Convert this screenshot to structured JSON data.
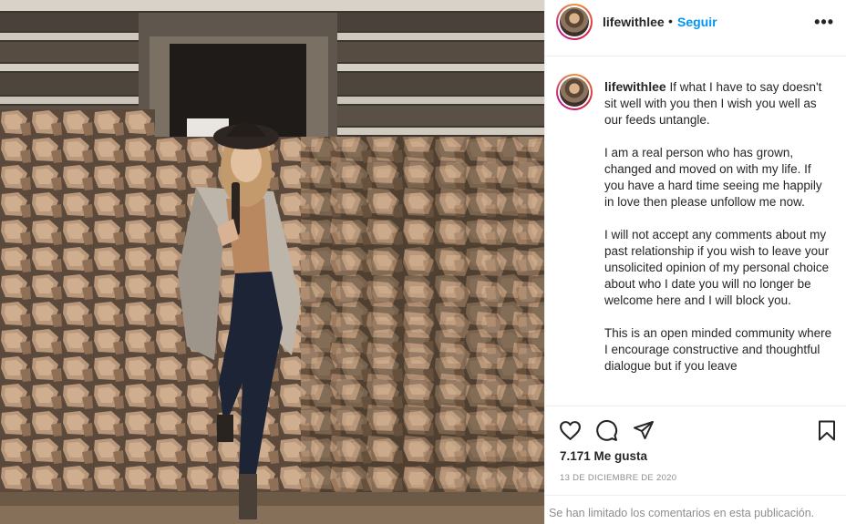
{
  "post": {
    "username": "lifewithlee",
    "separator": "•",
    "follow_label": "Seguir",
    "more_label": "•••",
    "caption_paragraphs": [
      "If what I have to say doesn't sit well with you then I wish you well as our feeds untangle.",
      "I am a real person who has grown, changed and moved on with my life. If you have a hard time seeing me happily in love then please unfollow me now.",
      "I will not accept any comments about my past relationship if you wish to leave your unsolicited opinion of my personal choice about who I date you will no longer be welcome here and I will block you.",
      "This is an open minded community where I encourage constructive and thoughtful dialogue but if you leave"
    ],
    "likes": "7.171 Me gusta",
    "date": "13 DE DICIEMBRE DE 2020",
    "comments_note": "Se han limitado los comentarios en esta publicación."
  },
  "icons": {
    "like": "heart-icon",
    "comment": "comment-bubble-icon",
    "share": "paper-plane-icon",
    "save": "bookmark-icon",
    "more": "more-horizontal-icon"
  },
  "colors": {
    "accent": "#0095f6",
    "text": "#262626",
    "muted": "#8e8e8e",
    "border": "#efefef"
  }
}
